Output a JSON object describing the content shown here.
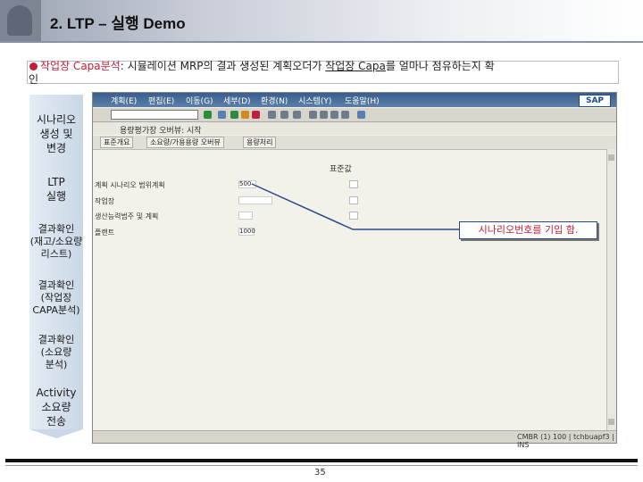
{
  "slide": {
    "title": "2. LTP – 실행 Demo",
    "description_pre": "작업장 Capa분석",
    "description_mid": ": 시뮬레이션 MRP의 결과 생성된 계획오더가 ",
    "description_ul1": "작업장 Capa",
    "description_post": "를 얼마나 점유하는지 확",
    "description_wrap": "인",
    "page_number": "35"
  },
  "nav": {
    "items": [
      {
        "label": "시나리오\n생성 및\n변경"
      },
      {
        "label": "LTP\n실행"
      },
      {
        "label": "결과확인\n(재고/소요량\n리스트)"
      },
      {
        "label": "결과확인\n(작업장\nCAPA분석)"
      },
      {
        "label": "결과확인\n(소요량\n분석)"
      },
      {
        "label": "Activity\n소요량\n전송"
      }
    ]
  },
  "sap": {
    "menus": [
      "계획(E)",
      "편집(E)",
      "이동(G)",
      "세부(D)",
      "환경(N)",
      "시스템(Y)",
      "도움말(H)"
    ],
    "screen_title": "용량평가장 오버뷰: 시작",
    "app_buttons": [
      "표준개요",
      "소요량/가용용량 오버뷰",
      "용량처리"
    ],
    "form_header": "표준값",
    "fields": [
      {
        "label": "계획 시나리오 범위계획",
        "value": "500"
      },
      {
        "label": "작업장",
        "value": ""
      },
      {
        "label": "생산능력범주 및 계획",
        "value": ""
      },
      {
        "label": "플랜트",
        "value": "1000"
      }
    ],
    "status_system": "CMBR (1) 100 | tchbuapf3 | INS",
    "sap_logo": "SAP"
  },
  "callout": {
    "text": "시나리오번호를 기입 함."
  },
  "colors": {
    "accent": "#c0203a",
    "sap_blue": "#3a5e8c",
    "nav_bg": "#c9d7e6"
  }
}
